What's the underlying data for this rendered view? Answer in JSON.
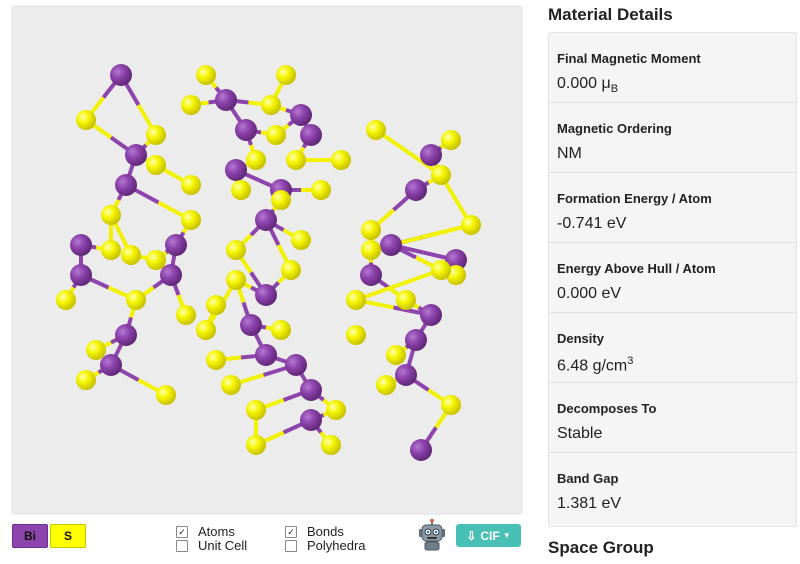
{
  "viewer": {
    "element_colors": {
      "Bi": "#8e44ad",
      "S": "#ffff00"
    },
    "background": "#ececec"
  },
  "legend": [
    {
      "symbol": "Bi",
      "color": "#8e44ad"
    },
    {
      "symbol": "S",
      "color": "#ffff00"
    }
  ],
  "options": [
    {
      "label": "Atoms",
      "checked": true,
      "check": "✓"
    },
    {
      "label": "Unit Cell",
      "checked": false,
      "check": ""
    },
    {
      "label": "Bonds",
      "checked": true,
      "check": "✓"
    },
    {
      "label": "Polyhedra",
      "checked": false,
      "check": ""
    }
  ],
  "toolbar": {
    "cif_label": "CIF",
    "robot_icon": "robot-icon",
    "download_icon": "download-icon"
  },
  "details": {
    "title": "Material Details",
    "properties": [
      {
        "label": "Final Magnetic Moment",
        "value": "0.000 μ",
        "sub": "B"
      },
      {
        "label": "Magnetic Ordering",
        "value": "NM"
      },
      {
        "label": "Formation Energy / Atom",
        "value": "-0.741 eV"
      },
      {
        "label": "Energy Above Hull / Atom",
        "value": "0.000 eV"
      },
      {
        "label": "Density",
        "value": "6.48 g/cm",
        "sup": "3"
      },
      {
        "label": "Decomposes To",
        "value": "Stable"
      },
      {
        "label": "Band Gap",
        "value": "1.381 eV"
      }
    ]
  },
  "space_group": {
    "title": "Space Group"
  }
}
